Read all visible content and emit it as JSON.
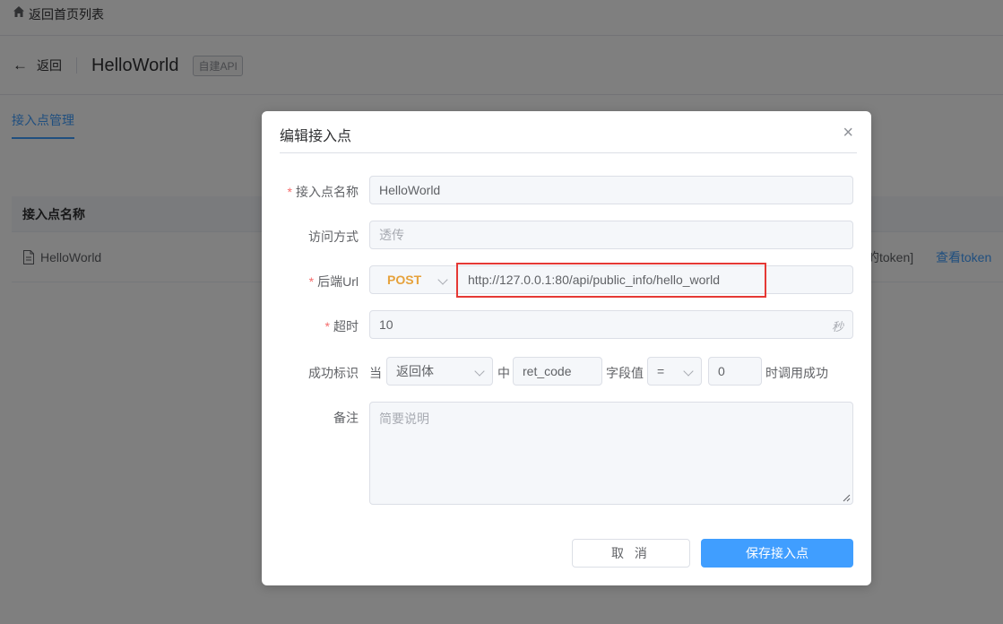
{
  "topbar": {
    "back_home": "返回首页列表"
  },
  "header": {
    "back": "返回",
    "api_name": "HelloWorld",
    "api_tag": "自建API"
  },
  "tabs": [
    {
      "label": "接入点管理"
    }
  ],
  "table": {
    "columns": [
      "接入点名称"
    ],
    "rows": [
      {
        "name": "HelloWorld",
        "token_text": "的token]",
        "action": "查看token"
      }
    ]
  },
  "dialog": {
    "title": "编辑接入点",
    "close": "×",
    "fields": {
      "name": {
        "label": "接入点名称",
        "required": true,
        "value": "HelloWorld"
      },
      "access": {
        "label": "访问方式",
        "required": false,
        "placeholder": "透传"
      },
      "backend": {
        "label": "后端Url",
        "required": true,
        "method": "POST",
        "url": "http://127.0.0.1:80/api/public_info/hello_world"
      },
      "timeout": {
        "label": "超时",
        "required": true,
        "value": "10",
        "unit": "秒"
      },
      "success": {
        "label": "成功标识",
        "when": "当",
        "source": "返回体",
        "in": "中",
        "field": "ret_code",
        "field_value_text": "字段值",
        "operator": "=",
        "value": "0",
        "suffix": "时调用成功"
      },
      "remark": {
        "label": "备注",
        "required": false,
        "placeholder": "简要说明"
      }
    },
    "buttons": {
      "cancel": "取 消",
      "save": "保存接入点"
    }
  },
  "colors": {
    "primary": "#409eff",
    "method": "#e6a23c",
    "required": "#f56c6c",
    "highlight": "#e53935"
  }
}
